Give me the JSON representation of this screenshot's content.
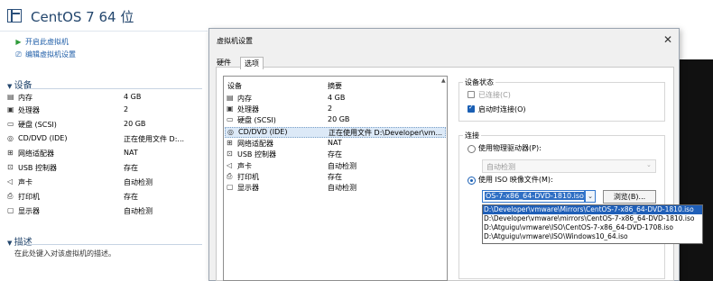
{
  "window": {
    "title": "CentOS 7 64 位"
  },
  "actions": [
    {
      "label": "开启此虚拟机",
      "icon": "play-icon"
    },
    {
      "label": "编辑虚拟机设置",
      "icon": "edit-settings-icon"
    }
  ],
  "devices_section": {
    "title": "设备",
    "rows": [
      {
        "icon": "memory-icon",
        "name": "内存",
        "summary": "4 GB"
      },
      {
        "icon": "cpu-icon",
        "name": "处理器",
        "summary": "2"
      },
      {
        "icon": "disk-icon",
        "name": "硬盘 (SCSI)",
        "summary": "20 GB"
      },
      {
        "icon": "cd-icon",
        "name": "CD/DVD (IDE)",
        "summary": "正在使用文件 D:..."
      },
      {
        "icon": "network-icon",
        "name": "网络适配器",
        "summary": "NAT"
      },
      {
        "icon": "usb-icon",
        "name": "USB 控制器",
        "summary": "存在"
      },
      {
        "icon": "sound-icon",
        "name": "声卡",
        "summary": "自动检测"
      },
      {
        "icon": "printer-icon",
        "name": "打印机",
        "summary": "存在"
      },
      {
        "icon": "display-icon",
        "name": "显示器",
        "summary": "自动检测"
      }
    ]
  },
  "description_section": {
    "title": "描述",
    "placeholder": "在此处键入对该虚拟机的描述。"
  },
  "dialog": {
    "title": "虚拟机设置",
    "tabs": [
      "硬件",
      "选项"
    ],
    "list_headers": {
      "device": "设备",
      "summary": "摘要"
    },
    "rows": [
      {
        "icon": "memory-icon",
        "name": "内存",
        "summary": "4 GB",
        "selected": false
      },
      {
        "icon": "cpu-icon",
        "name": "处理器",
        "summary": "2",
        "selected": false
      },
      {
        "icon": "disk-icon",
        "name": "硬盘 (SCSI)",
        "summary": "20 GB",
        "selected": false
      },
      {
        "icon": "cd-icon",
        "name": "CD/DVD (IDE)",
        "summary": "正在使用文件 D:\\Developer\\vm...",
        "selected": true
      },
      {
        "icon": "network-icon",
        "name": "网络适配器",
        "summary": "NAT",
        "selected": false
      },
      {
        "icon": "usb-icon",
        "name": "USB 控制器",
        "summary": "存在",
        "selected": false
      },
      {
        "icon": "sound-icon",
        "name": "声卡",
        "summary": "自动检测",
        "selected": false
      },
      {
        "icon": "printer-icon",
        "name": "打印机",
        "summary": "存在",
        "selected": false
      },
      {
        "icon": "display-icon",
        "name": "显示器",
        "summary": "自动检测",
        "selected": false
      }
    ],
    "device_status": {
      "title": "设备状态",
      "connected_label": "已连接(C)",
      "connected_checked": false,
      "connect_on_power_label": "启动时连接(O)",
      "connect_on_power_checked": true
    },
    "connection": {
      "title": "连接",
      "physical_label": "使用物理驱动器(P):",
      "physical_selected": false,
      "physical_value": "自动检测",
      "iso_label": "使用 ISO 映像文件(M):",
      "iso_selected": true,
      "iso_value": "OS-7-x86_64-DVD-1810.iso",
      "browse_label": "浏览(B)...",
      "iso_options": [
        "D:\\Developer\\vmware\\Mirrors\\CentOS-7-x86_64-DVD-1810.iso",
        "D:\\Developer\\vmware\\mirrors\\CentOS-7-x86_64-DVD-1810.iso",
        "D:\\Atguigu\\vmware\\ISO\\CentOS-7-x86_64-DVD-1708.iso",
        "D:\\Atguigu\\vmware\\ISO\\Windows10_64.iso"
      ],
      "iso_selected_index": 0
    },
    "close_icon": "close-icon"
  },
  "colors": {
    "accent": "#1f5fb8",
    "title": "#23466d",
    "link": "#1f5ea8"
  }
}
